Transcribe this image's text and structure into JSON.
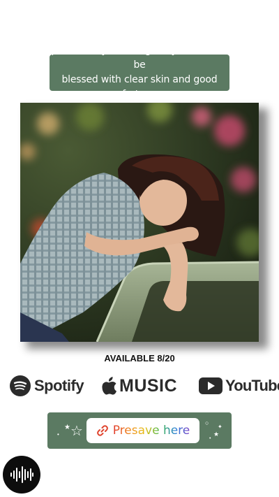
{
  "caption": {
    "line1": "presave my first single if you want to be",
    "line2": "blessed with clear skin and good fortune"
  },
  "release": {
    "available_text": "AVAILABLE 8/20"
  },
  "platforms": {
    "spotify": {
      "name": "Spotify",
      "icon": "spotify-icon"
    },
    "apple": {
      "name": "MUSIC",
      "icon": "apple-icon"
    },
    "youtube": {
      "name": "YouTube",
      "icon": "youtube-play-icon"
    }
  },
  "presave": {
    "label": "Presave here",
    "icon": "link-icon",
    "decorations": [
      "sparkle-star-icon",
      "sparkle-dot-icon"
    ]
  },
  "audio": {
    "icon": "soundwave-icon"
  },
  "colors": {
    "accent": "#5b7a62",
    "text_dark": "#2b2b2b",
    "badge_bg": "#0d0d0d"
  }
}
